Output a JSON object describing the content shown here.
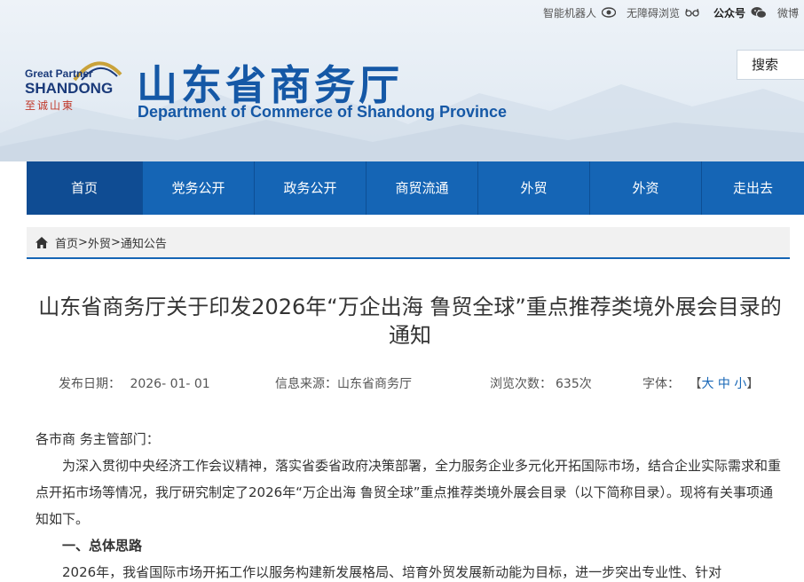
{
  "topbar": {
    "robot": "智能机器人",
    "accessibility": "无障碍浏览",
    "wechat": "公众号",
    "weibo": "微博"
  },
  "logo": {
    "line1": "Great Partner",
    "line2": "SHANDONG",
    "line3": "至诚山東"
  },
  "site": {
    "title": "山东省商务厅",
    "subtitle": "Department of Commerce of Shandong Province"
  },
  "search": {
    "label": "搜索"
  },
  "nav": [
    {
      "label": "首页"
    },
    {
      "label": "党务公开"
    },
    {
      "label": "政务公开"
    },
    {
      "label": "商贸流通"
    },
    {
      "label": "外贸"
    },
    {
      "label": "外资"
    },
    {
      "label": "走出去"
    }
  ],
  "breadcrumb": {
    "home": "首页",
    "sep1": ">",
    "level1": "外贸",
    "sep2": ">",
    "level2": "通知公告"
  },
  "article": {
    "title": "山东省商务厅关于印发2026年“万企出海 鲁贸全球”重点推荐类境外展会目录的通知",
    "date_label": "发布日期：",
    "date": "2026- 01- 01",
    "source_label": "信息来源：",
    "source": "山东省商务厅",
    "views_label": "浏览次数：",
    "views": "635次",
    "font_label": "字体：",
    "font_open": "【",
    "font_large": "大",
    "font_medium": "中",
    "font_small": "小",
    "font_close": "】",
    "salutation": "各市商  务主管部门：",
    "para1": "为深入贯彻中央经济工作会议精神，落实省委省政府决策部署，全力服务企业多元化开拓国际市场，结合企业实际需求和重点开拓市场等情况，我厅研究制定了2026年“万企出海 鲁贸全球”重点推荐类境外展会目录（以下简称目录）。现将有关事项通知如下。",
    "heading1": "一、总体思路",
    "para2": "2026年，我省国际市场开拓工作以服务构建新发展格局、培育外贸发展新动能为目标，进一步突出专业性、针对"
  },
  "colors": {
    "brand_blue": "#1565b5",
    "nav_active": "#0f4c93",
    "accent_red": "#c0392b"
  }
}
